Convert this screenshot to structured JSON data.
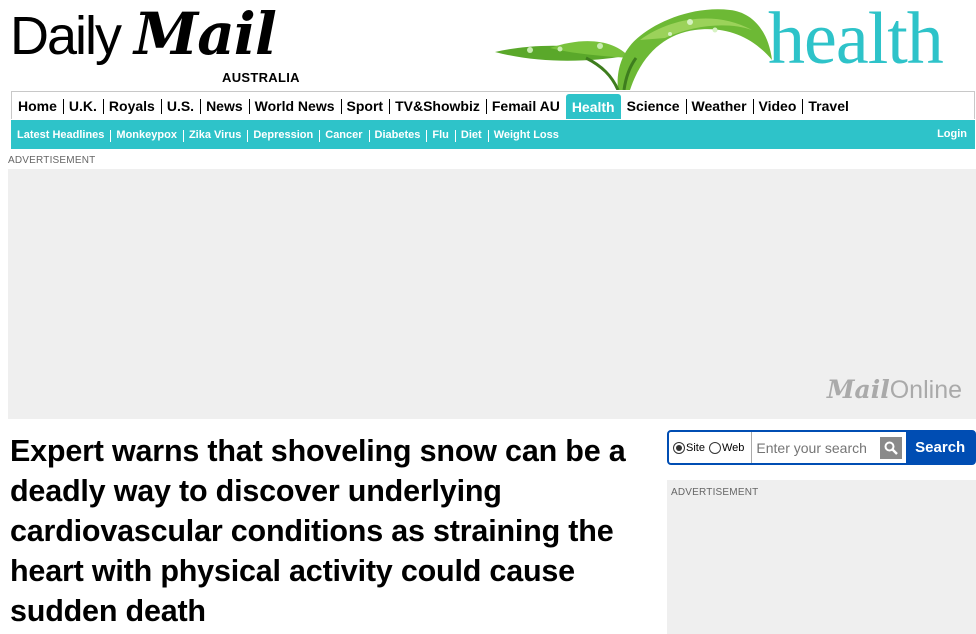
{
  "masthead": {
    "brand_daily": "Daily",
    "brand_mail": "Mail",
    "edition": "AUSTRALIA",
    "section_title": "health",
    "section_color": "#2ec3c9"
  },
  "primary_nav": {
    "items": [
      "Home",
      "U.K.",
      "Royals",
      "U.S.",
      "News",
      "World News",
      "Sport",
      "TV&Showbiz",
      "Femail AU",
      "Health",
      "Science",
      "Weather",
      "Video",
      "Travel"
    ],
    "active": "Health"
  },
  "secondary_nav": {
    "items": [
      "Latest Headlines",
      "Monkeypox",
      "Zika Virus",
      "Depression",
      "Cancer",
      "Diabetes",
      "Flu",
      "Diet",
      "Weight Loss"
    ],
    "login": "Login"
  },
  "advertisement": {
    "label": "ADVERTISEMENT",
    "logo_mail": "Mail",
    "logo_online": "Online"
  },
  "article": {
    "headline": "Expert warns that shoveling snow can be a deadly way to discover underlying cardiovascular conditions as straining the heart with physical activity could cause sudden death"
  },
  "search": {
    "option_site": "Site",
    "option_web": "Web",
    "selected": "Site",
    "placeholder": "Enter your search",
    "button_label": "Search",
    "button_color": "#004db3"
  },
  "side_ad": {
    "label": "ADVERTISEMENT"
  }
}
